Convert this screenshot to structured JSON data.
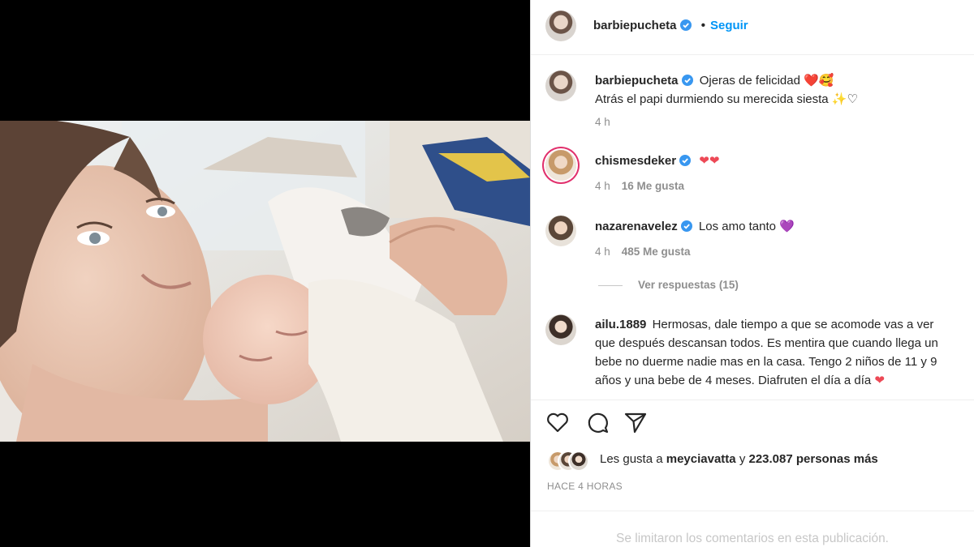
{
  "post": {
    "author": "barbiepucheta",
    "follow_label": "Seguir",
    "dot": "•",
    "caption_line1": "Ojeras de felicidad",
    "caption_line1_emoji": "❤️🥰",
    "caption_line2": "Atrás el papi durmiendo su merecida siesta",
    "caption_line2_emoji": "✨♡",
    "caption_time": "4 h"
  },
  "comments": [
    {
      "user": "chismesdeker",
      "text": "",
      "emoji": "❤❤",
      "time": "4 h",
      "likes": "16 Me gusta",
      "verified": true
    },
    {
      "user": "nazarenavelez",
      "text": "Los amo tanto",
      "emoji": "💜",
      "time": "4 h",
      "likes": "485 Me gusta",
      "verified": true
    }
  ],
  "view_replies": "Ver respuestas (15)",
  "long_comment": {
    "user": "ailu.1889",
    "line1": "Hermosas, dale tiempo a que se acomode vas a ver",
    "line2": "que después descansan todos. Es mentira que cuando llega un",
    "line3": "bebe no duerme nadie mas en la casa. Tengo 2 niños de 11 y 9",
    "line4": "años y una bebe de 4 meses. Diafruten el día a día",
    "emoji": "❤"
  },
  "likes": {
    "prefix": "Les gusta a",
    "user": "meyciavatta",
    "middle": "y",
    "rest": "223.087 personas más"
  },
  "timestamp": "HACE 4 HORAS",
  "comments_limited": "Se limitaron los comentarios en esta publicación.",
  "colors": {
    "link": "#0095f6",
    "verified": "#3897f0",
    "heart": "#ed4956",
    "purple": "#8a5cd8"
  }
}
